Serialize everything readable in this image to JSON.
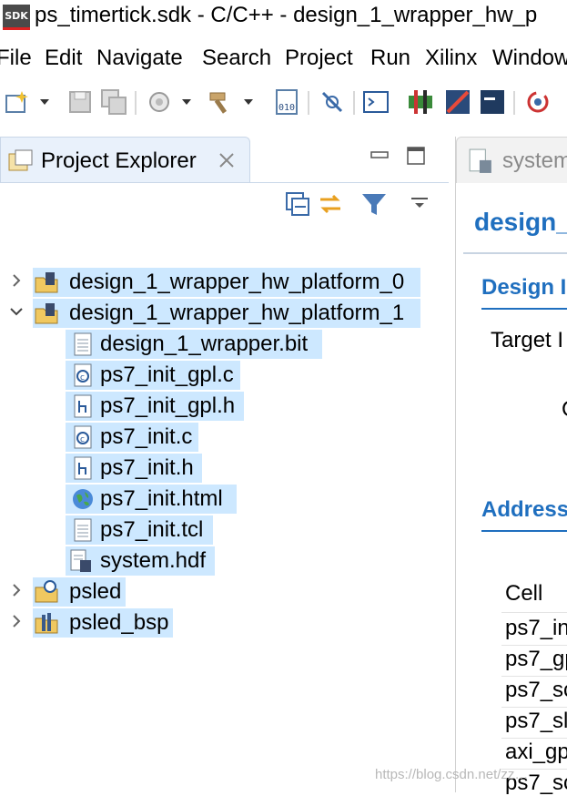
{
  "window": {
    "logo": "SDK",
    "title": "ps_timertick.sdk - C/C++ - design_1_wrapper_hw_p"
  },
  "menu": [
    "File",
    "Edit",
    "Navigate",
    "Search",
    "Project",
    "Run",
    "Xilinx",
    "Window"
  ],
  "toolbar_icons": [
    "new-wizard-icon",
    "save-icon",
    "save-all-icon",
    "build-settings-icon",
    "hammer-build-icon",
    "binary-file-icon",
    "debug-connection-icon",
    "terminal-icon",
    "program-fpga-icon",
    "blank-sdk-icon",
    "xsct-console-icon",
    "refresh-icon"
  ],
  "project_explorer": {
    "tab_label": "Project Explorer",
    "tree": [
      {
        "label": "design_1_wrapper_hw_platform_0",
        "icon": "hw-platform-folder-icon",
        "expanded": false,
        "level": 0
      },
      {
        "label": "design_1_wrapper_hw_platform_1",
        "icon": "hw-platform-folder-icon",
        "expanded": true,
        "level": 0
      },
      {
        "label": "design_1_wrapper.bit",
        "icon": "text-file-icon",
        "level": 1
      },
      {
        "label": "ps7_init_gpl.c",
        "icon": "c-source-icon",
        "level": 1
      },
      {
        "label": "ps7_init_gpl.h",
        "icon": "h-header-icon",
        "level": 1
      },
      {
        "label": "ps7_init.c",
        "icon": "c-source-icon",
        "level": 1
      },
      {
        "label": "ps7_init.h",
        "icon": "h-header-icon",
        "level": 1
      },
      {
        "label": "ps7_init.html",
        "icon": "globe-html-icon",
        "level": 1
      },
      {
        "label": "ps7_init.tcl",
        "icon": "text-file-icon",
        "level": 1
      },
      {
        "label": "system.hdf",
        "icon": "hdf-file-icon",
        "level": 1
      },
      {
        "label": "psled",
        "icon": "c-project-folder-icon",
        "expanded": false,
        "level": 0
      },
      {
        "label": "psled_bsp",
        "icon": "bsp-folder-icon",
        "expanded": false,
        "level": 0
      }
    ]
  },
  "editor": {
    "tab_label": "system",
    "title": "design_",
    "section_design": "Design I",
    "target_label": "Target I",
    "c_label": "C",
    "section_address": "Address",
    "cell_header": "Cell",
    "cells": [
      "ps7_in",
      "ps7_gp",
      "ps7_sc",
      "ps7_sl",
      "axi_gp",
      "ps7_sc"
    ]
  },
  "watermark": "https://blog.csdn.net/zz…"
}
